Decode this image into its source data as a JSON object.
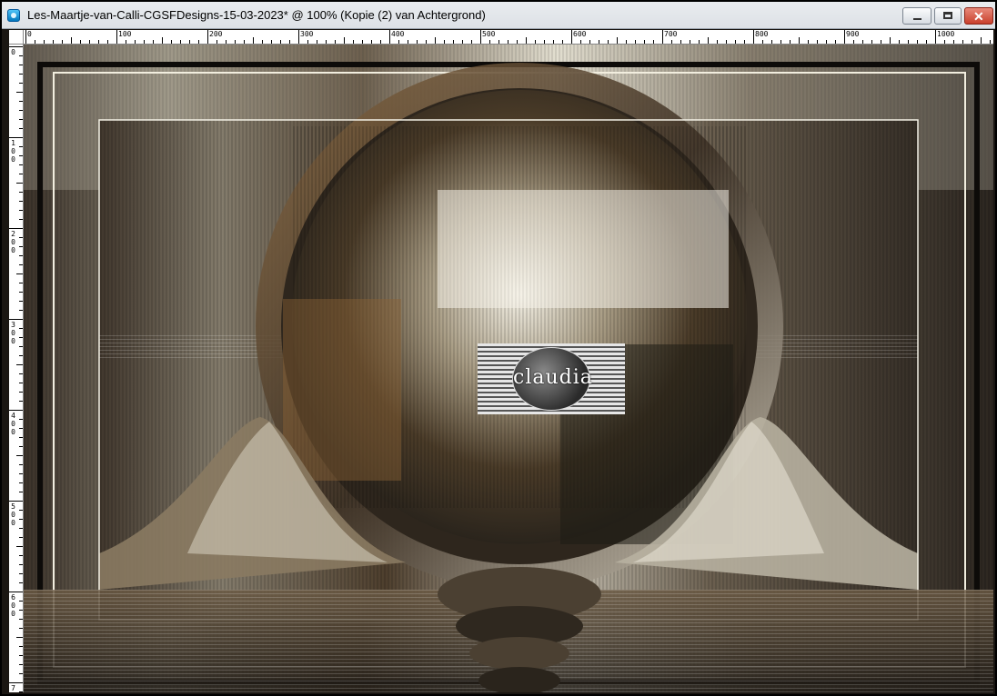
{
  "window": {
    "title": "Les-Maartje-van-Calli-CGSFDesigns-15-03-2023* @ 100% (Kopie (2) van Achtergrond)",
    "icon": "paintshop-pro-icon",
    "controls": {
      "minimize": "minimize-icon",
      "maximize": "maximize-icon",
      "close": "✕"
    }
  },
  "ruler": {
    "unit": "px",
    "top_labels": [
      "0",
      "100",
      "200",
      "300",
      "400",
      "500",
      "600",
      "700",
      "800",
      "900",
      "1000"
    ],
    "left_labels": [
      "0",
      "100",
      "200",
      "300",
      "400",
      "500",
      "600",
      "700"
    ]
  },
  "canvas": {
    "zoom": "100%",
    "layer": "Kopie (2) van Achtergrond",
    "watermark_text": "claudia",
    "colors": {
      "dark": "#2b2620",
      "bronze": "#7a5a3a",
      "cream": "#e8e4d8",
      "frame": "#f2eedf"
    }
  }
}
